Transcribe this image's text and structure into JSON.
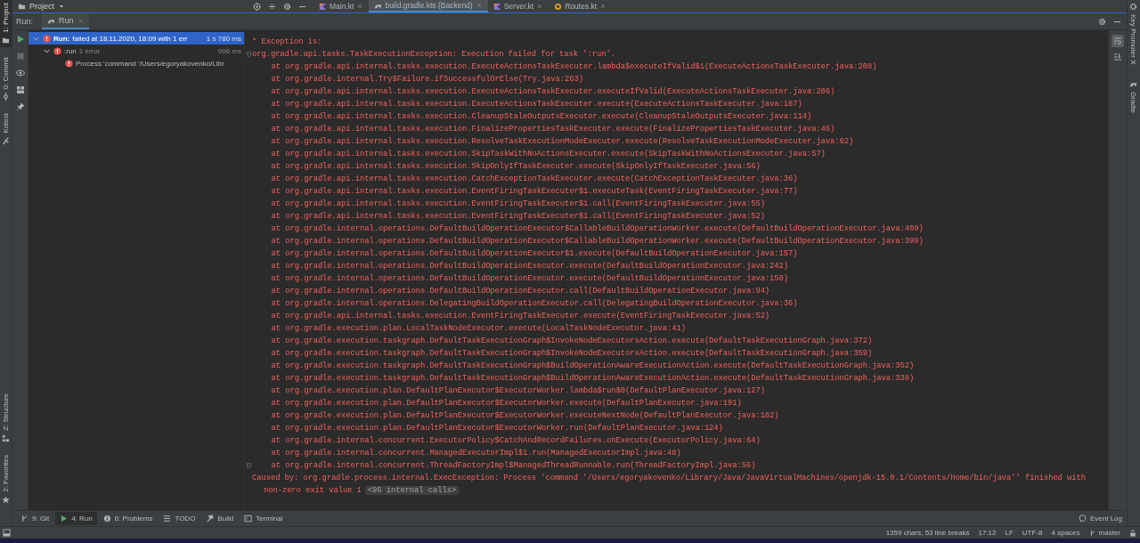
{
  "project_panel": {
    "title": "Project"
  },
  "top_tabs": [
    {
      "label": "Main.kt",
      "kind": "kotlin",
      "selected": false
    },
    {
      "label": "build.gradle.kts (Backend)",
      "kind": "gradle",
      "selected": true
    },
    {
      "label": "Server.kt",
      "kind": "kotlin",
      "selected": false
    },
    {
      "label": "Routes.kt",
      "kind": "route",
      "selected": false
    }
  ],
  "left_stripe": {
    "top": [
      {
        "label": "1: Project",
        "kind": "project",
        "selected": true
      },
      {
        "label": "0: Commit",
        "kind": "commit",
        "selected": false
      },
      {
        "label": "Kotest",
        "kind": "kotest",
        "selected": false
      }
    ],
    "bottom": [
      {
        "label": "Z: Structure",
        "kind": "structure",
        "selected": false
      },
      {
        "label": "2: Favorites",
        "kind": "favorites",
        "selected": false
      }
    ]
  },
  "right_stripe": [
    {
      "label": "Key Promoter X",
      "kind": "promoter",
      "selected": false
    },
    {
      "label": "Gradle",
      "kind": "gradle",
      "selected": false
    }
  ],
  "run_header": {
    "label": "Run:",
    "tabs": [
      {
        "label": "Run",
        "selected": true
      }
    ]
  },
  "tree": [
    {
      "label": "Run:",
      "detail": "failed at 18.11.2020, 18:09 with 1 err",
      "time": "1 s 780 ms",
      "selected": true,
      "expanded": true,
      "children": [
        {
          "label": ":run",
          "detail": "1 error",
          "time": "906 ms",
          "selected": false,
          "expanded": true,
          "children": [
            {
              "label": "Process 'command '/Users/egoryakovenko/Libr",
              "selected": false
            }
          ]
        }
      ]
    }
  ],
  "console": [
    {
      "kind": "header",
      "text": "* Exception is:",
      "fold": false
    },
    {
      "kind": "exception",
      "text": "org.gradle.api.tasks.TaskExecutionException: Execution failed for task ':run'.",
      "fold": true
    },
    {
      "kind": "frame",
      "text": "at org.gradle.api.internal.tasks.execution.ExecuteActionsTaskExecuter.lambda$executeIfValid$1(ExecuteActionsTaskExecuter.java:208)",
      "fold": false
    },
    {
      "kind": "frame",
      "text": "at org.gradle.internal.Try$Failure.ifSuccessfulOrElse(Try.java:263)",
      "fold": false
    },
    {
      "kind": "frame",
      "text": "at org.gradle.api.internal.tasks.execution.ExecuteActionsTaskExecuter.executeIfValid(ExecuteActionsTaskExecuter.java:206)",
      "fold": false
    },
    {
      "kind": "frame",
      "text": "at org.gradle.api.internal.tasks.execution.ExecuteActionsTaskExecuter.execute(ExecuteActionsTaskExecuter.java:187)",
      "fold": false
    },
    {
      "kind": "frame",
      "text": "at org.gradle.api.internal.tasks.execution.CleanupStaleOutputsExecuter.execute(CleanupStaleOutputsExecuter.java:114)",
      "fold": false
    },
    {
      "kind": "frame",
      "text": "at org.gradle.api.internal.tasks.execution.FinalizePropertiesTaskExecuter.execute(FinalizePropertiesTaskExecuter.java:46)",
      "fold": false
    },
    {
      "kind": "frame",
      "text": "at org.gradle.api.internal.tasks.execution.ResolveTaskExecutionModeExecuter.execute(ResolveTaskExecutionModeExecuter.java:62)",
      "fold": false
    },
    {
      "kind": "frame",
      "text": "at org.gradle.api.internal.tasks.execution.SkipTaskWithNoActionsExecuter.execute(SkipTaskWithNoActionsExecuter.java:57)",
      "fold": false
    },
    {
      "kind": "frame",
      "text": "at org.gradle.api.internal.tasks.execution.SkipOnlyIfTaskExecuter.execute(SkipOnlyIfTaskExecuter.java:56)",
      "fold": false
    },
    {
      "kind": "frame",
      "text": "at org.gradle.api.internal.tasks.execution.CatchExceptionTaskExecuter.execute(CatchExceptionTaskExecuter.java:36)",
      "fold": false
    },
    {
      "kind": "frame",
      "text": "at org.gradle.api.internal.tasks.execution.EventFiringTaskExecuter$1.executeTask(EventFiringTaskExecuter.java:77)",
      "fold": false
    },
    {
      "kind": "frame",
      "text": "at org.gradle.api.internal.tasks.execution.EventFiringTaskExecuter$1.call(EventFiringTaskExecuter.java:55)",
      "fold": false
    },
    {
      "kind": "frame",
      "text": "at org.gradle.api.internal.tasks.execution.EventFiringTaskExecuter$1.call(EventFiringTaskExecuter.java:52)",
      "fold": false
    },
    {
      "kind": "frame",
      "text": "at org.gradle.internal.operations.DefaultBuildOperationExecutor$CallableBuildOperationWorker.execute(DefaultBuildOperationExecutor.java:409)",
      "fold": false
    },
    {
      "kind": "frame",
      "text": "at org.gradle.internal.operations.DefaultBuildOperationExecutor$CallableBuildOperationWorker.execute(DefaultBuildOperationExecutor.java:399)",
      "fold": false
    },
    {
      "kind": "frame",
      "text": "at org.gradle.internal.operations.DefaultBuildOperationExecutor$1.execute(DefaultBuildOperationExecutor.java:157)",
      "fold": false
    },
    {
      "kind": "frame",
      "text": "at org.gradle.internal.operations.DefaultBuildOperationExecutor.execute(DefaultBuildOperationExecutor.java:242)",
      "fold": false
    },
    {
      "kind": "frame",
      "text": "at org.gradle.internal.operations.DefaultBuildOperationExecutor.execute(DefaultBuildOperationExecutor.java:150)",
      "fold": false
    },
    {
      "kind": "frame",
      "text": "at org.gradle.internal.operations.DefaultBuildOperationExecutor.call(DefaultBuildOperationExecutor.java:94)",
      "fold": false
    },
    {
      "kind": "frame",
      "text": "at org.gradle.internal.operations.DelegatingBuildOperationExecutor.call(DelegatingBuildOperationExecutor.java:36)",
      "fold": false
    },
    {
      "kind": "frame",
      "text": "at org.gradle.api.internal.tasks.execution.EventFiringTaskExecuter.execute(EventFiringTaskExecuter.java:52)",
      "fold": false
    },
    {
      "kind": "frame",
      "text": "at org.gradle.execution.plan.LocalTaskNodeExecutor.execute(LocalTaskNodeExecutor.java:41)",
      "fold": false
    },
    {
      "kind": "frame",
      "text": "at org.gradle.execution.taskgraph.DefaultTaskExecutionGraph$InvokeNodeExecutorsAction.execute(DefaultTaskExecutionGraph.java:372)",
      "fold": false
    },
    {
      "kind": "frame",
      "text": "at org.gradle.execution.taskgraph.DefaultTaskExecutionGraph$InvokeNodeExecutorsAction.execute(DefaultTaskExecutionGraph.java:359)",
      "fold": false
    },
    {
      "kind": "frame",
      "text": "at org.gradle.execution.taskgraph.DefaultTaskExecutionGraph$BuildOperationAwareExecutionAction.execute(DefaultTaskExecutionGraph.java:352)",
      "fold": false
    },
    {
      "kind": "frame",
      "text": "at org.gradle.execution.taskgraph.DefaultTaskExecutionGraph$BuildOperationAwareExecutionAction.execute(DefaultTaskExecutionGraph.java:338)",
      "fold": false
    },
    {
      "kind": "frame",
      "text": "at org.gradle.execution.plan.DefaultPlanExecutor$ExecutorWorker.lambda$run$0(DefaultPlanExecutor.java:127)",
      "fold": false
    },
    {
      "kind": "frame",
      "text": "at org.gradle.execution.plan.DefaultPlanExecutor$ExecutorWorker.execute(DefaultPlanExecutor.java:191)",
      "fold": false
    },
    {
      "kind": "frame",
      "text": "at org.gradle.execution.plan.DefaultPlanExecutor$ExecutorWorker.executeNextNode(DefaultPlanExecutor.java:182)",
      "fold": false
    },
    {
      "kind": "frame",
      "text": "at org.gradle.execution.plan.DefaultPlanExecutor$ExecutorWorker.run(DefaultPlanExecutor.java:124)",
      "fold": false
    },
    {
      "kind": "frame",
      "text": "at org.gradle.internal.concurrent.ExecutorPolicy$CatchAndRecordFailures.onExecute(ExecutorPolicy.java:64)",
      "fold": false
    },
    {
      "kind": "frame",
      "text": "at org.gradle.internal.concurrent.ManagedExecutorImpl$1.run(ManagedExecutorImpl.java:48)",
      "fold": false
    },
    {
      "kind": "frame",
      "text": "at org.gradle.internal.concurrent.ThreadFactoryImpl$ManagedThreadRunnable.run(ThreadFactoryImpl.java:56)",
      "fold": true
    },
    {
      "kind": "cause",
      "text": "Caused by: org.gradle.process.internal.ExecException: Process 'command '/Users/egoryakovenko/Library/Java/JavaVirtualMachines/openjdk-15.0.1/Contents/Home/bin/java'' finished with",
      "fold": false
    },
    {
      "kind": "continuation",
      "text": "non-zero exit value 1",
      "badge": "<96 internal calls>",
      "fold": false
    }
  ],
  "tool_tabs": [
    {
      "label": "9: Git",
      "kind": "git",
      "selected": false
    },
    {
      "label": "4: Run",
      "kind": "run",
      "selected": true
    },
    {
      "label": "6: Problems",
      "kind": "problems",
      "selected": false
    },
    {
      "label": "TODO",
      "kind": "todo",
      "selected": false
    },
    {
      "label": "Build",
      "kind": "build",
      "selected": false
    },
    {
      "label": "Terminal",
      "kind": "terminal",
      "selected": false
    }
  ],
  "event_log": "Event Log",
  "status_bar": [
    {
      "text": "1359 chars, 53 line breaks",
      "kind": "text"
    },
    {
      "text": "17:12",
      "kind": "text"
    },
    {
      "text": "LF",
      "kind": "text"
    },
    {
      "text": "UTF-8",
      "kind": "text"
    },
    {
      "text": "4 spaces",
      "kind": "text"
    },
    {
      "text": "master",
      "kind": "branch"
    }
  ]
}
